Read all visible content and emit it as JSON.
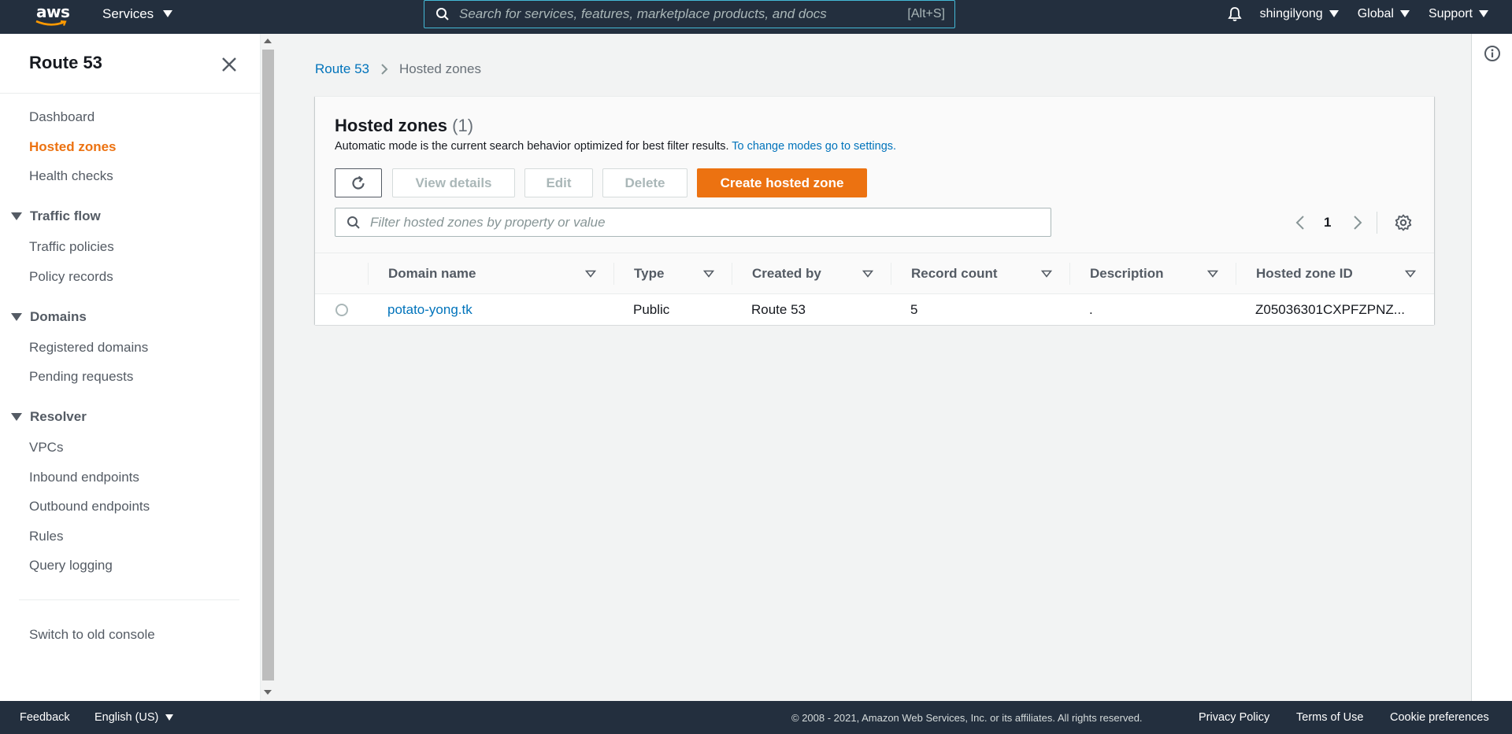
{
  "topnav": {
    "logo_text": "aws",
    "services_label": "Services",
    "search_placeholder": "Search for services, features, marketplace products, and docs",
    "search_shortcut": "[Alt+S]",
    "username": "shingilyong",
    "region": "Global",
    "support": "Support"
  },
  "sidebar": {
    "title": "Route 53",
    "items": [
      {
        "label": "Dashboard"
      },
      {
        "label": "Hosted zones",
        "active": true
      },
      {
        "label": "Health checks"
      }
    ],
    "sections": [
      {
        "label": "Traffic flow",
        "items": [
          {
            "label": "Traffic policies"
          },
          {
            "label": "Policy records"
          }
        ]
      },
      {
        "label": "Domains",
        "items": [
          {
            "label": "Registered domains"
          },
          {
            "label": "Pending requests"
          }
        ]
      },
      {
        "label": "Resolver",
        "items": [
          {
            "label": "VPCs"
          },
          {
            "label": "Inbound endpoints"
          },
          {
            "label": "Outbound endpoints"
          },
          {
            "label": "Rules"
          },
          {
            "label": "Query logging"
          }
        ]
      }
    ],
    "switch_console": "Switch to old console"
  },
  "breadcrumb": {
    "root": "Route 53",
    "current": "Hosted zones"
  },
  "panel": {
    "title": "Hosted zones",
    "count": "(1)",
    "description": "Automatic mode is the current search behavior optimized for best filter results.",
    "description_link": "To change modes go to settings.",
    "buttons": {
      "view_details": "View details",
      "edit": "Edit",
      "delete": "Delete",
      "create": "Create hosted zone"
    },
    "filter_placeholder": "Filter hosted zones by property or value",
    "page_number": "1"
  },
  "table": {
    "columns": [
      "Domain name",
      "Type",
      "Created by",
      "Record count",
      "Description",
      "Hosted zone ID"
    ],
    "rows": [
      {
        "domain": "potato-yong.tk",
        "type": "Public",
        "created_by": "Route 53",
        "record_count": "5",
        "description": ".",
        "zone_id": "Z05036301CXPFZPNZ..."
      }
    ]
  },
  "footer": {
    "feedback": "Feedback",
    "language": "English (US)",
    "copyright": "© 2008 - 2021, Amazon Web Services, Inc. or its affiliates. All rights reserved.",
    "privacy": "Privacy Policy",
    "terms": "Terms of Use",
    "cookies": "Cookie preferences"
  },
  "colors": {
    "nav_bg": "#232f3e",
    "accent": "#ec7211",
    "link": "#0073bb"
  }
}
